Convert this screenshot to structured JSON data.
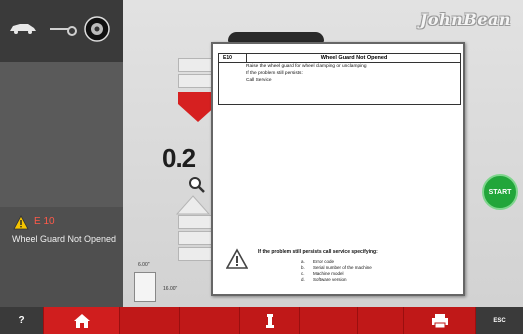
{
  "brand": "JohnBean",
  "left_panel": {
    "icons": [
      "car-icon",
      "wrench-icon",
      "wheel-icon"
    ],
    "error_code": "E 10",
    "error_message": "Wheel Guard Not Opened"
  },
  "center": {
    "value_display": "0.2",
    "dimension_top": "6.00\"",
    "dimension_side": "16.00\""
  },
  "start_button": {
    "label": "START",
    "color": "#22a63a"
  },
  "dialog": {
    "code": "E10",
    "title": "Wheel Guard Not Opened",
    "lines": [
      "Raise the wheel guard for wheel clamping or unclamping",
      "If the problem still persists:",
      "Call Service"
    ],
    "service_header": "If the problem still persists call service specifying:",
    "service_items": [
      {
        "letter": "a.",
        "text": "Error code"
      },
      {
        "letter": "b.",
        "text": "Serial number of the machine"
      },
      {
        "letter": "c.",
        "text": "Machine model"
      },
      {
        "letter": "d.",
        "text": "Software version"
      }
    ]
  },
  "toolbar": {
    "help_label": "?",
    "esc_label": "ESC",
    "color": "#c01818"
  }
}
